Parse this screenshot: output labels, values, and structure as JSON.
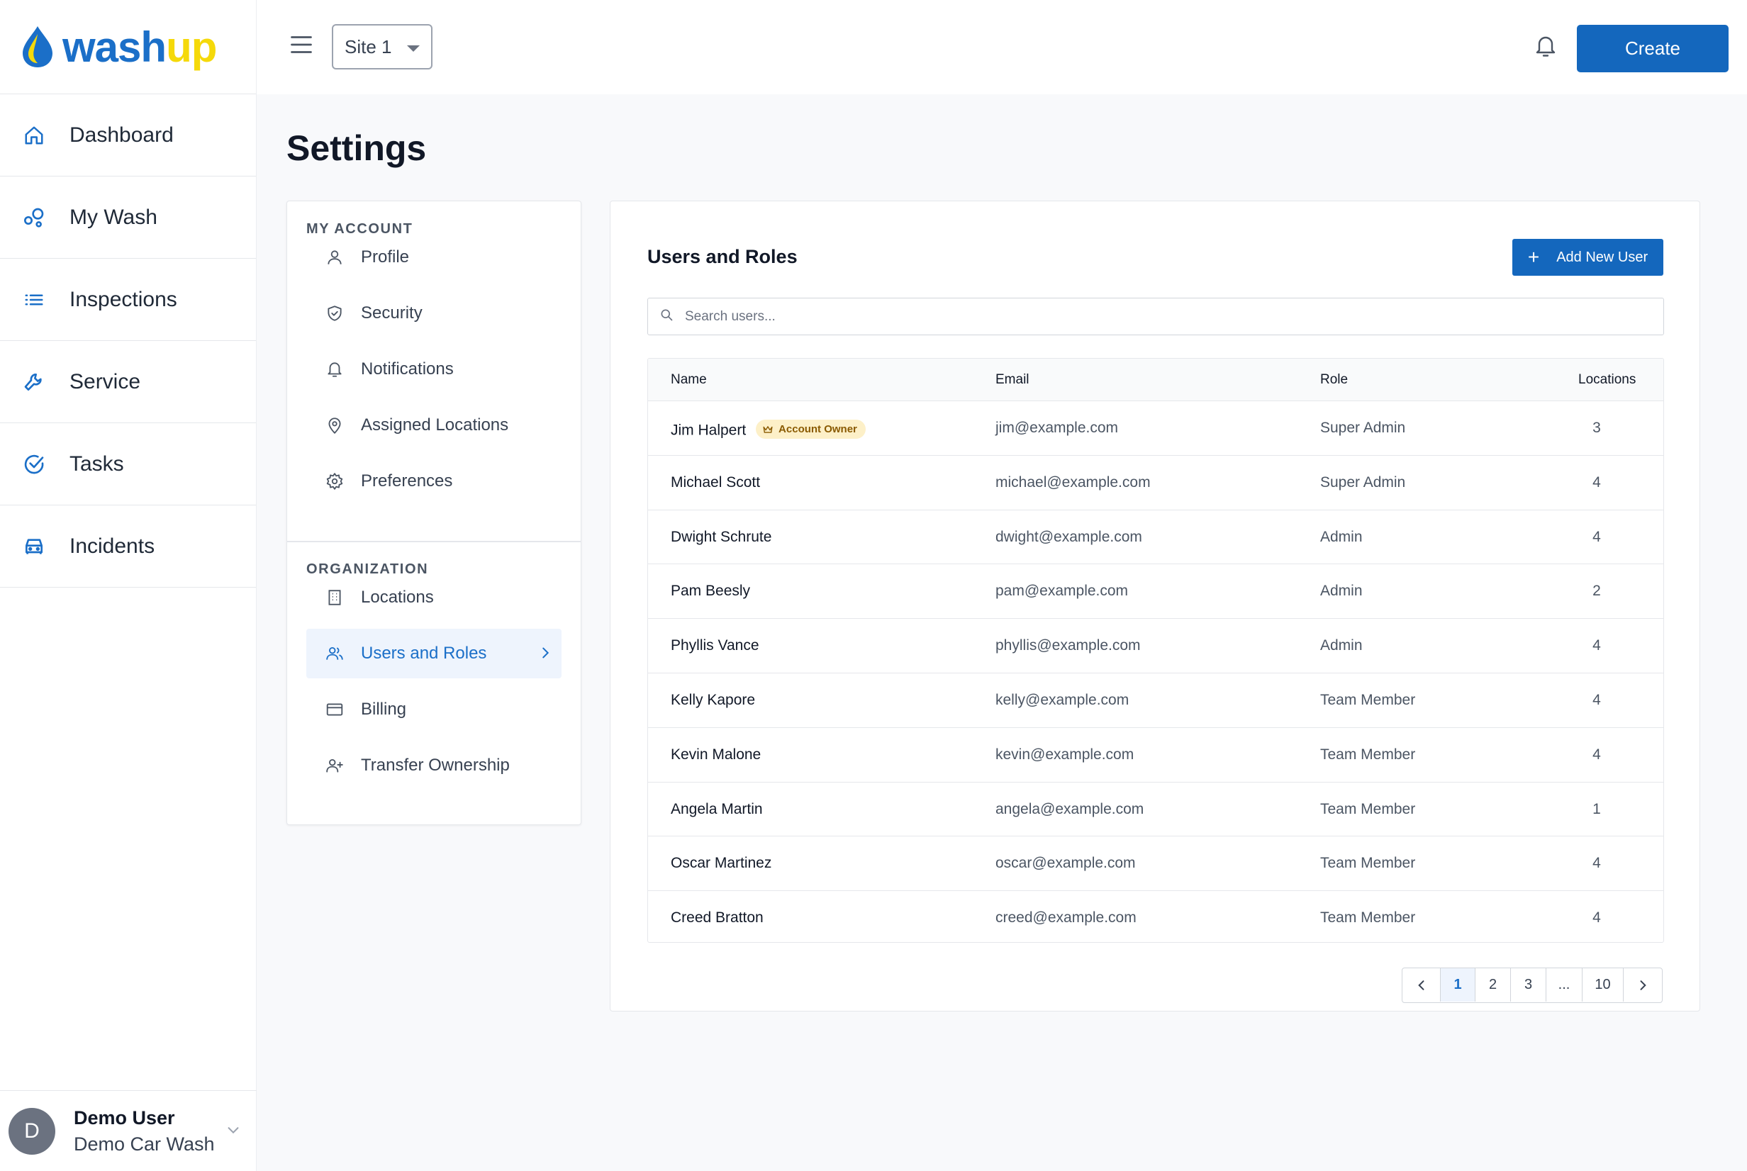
{
  "brand": {
    "name_part1": "wash",
    "name_part2": "up"
  },
  "nav": [
    {
      "label": "Dashboard",
      "icon": "home-icon"
    },
    {
      "label": "My Wash",
      "icon": "bubbles-icon"
    },
    {
      "label": "Inspections",
      "icon": "list-icon"
    },
    {
      "label": "Service",
      "icon": "wrench-icon"
    },
    {
      "label": "Tasks",
      "icon": "check-circle-icon"
    },
    {
      "label": "Incidents",
      "icon": "car-icon"
    }
  ],
  "user": {
    "initial": "D",
    "name": "Demo User",
    "org": "Demo Car Wash"
  },
  "topbar": {
    "site": "Site 1",
    "create_label": "Create"
  },
  "page": {
    "title": "Settings"
  },
  "settings_menu": {
    "my_account_title": "MY ACCOUNT",
    "my_account": [
      {
        "label": "Profile",
        "icon": "user-icon"
      },
      {
        "label": "Security",
        "icon": "shield-icon"
      },
      {
        "label": "Notifications",
        "icon": "bell-icon"
      },
      {
        "label": "Assigned Locations",
        "icon": "map-pin-icon"
      },
      {
        "label": "Preferences",
        "icon": "gear-icon"
      }
    ],
    "organization_title": "ORGANIZATION",
    "organization": [
      {
        "label": "Locations",
        "icon": "building-icon"
      },
      {
        "label": "Users and Roles",
        "icon": "users-icon",
        "active": true
      },
      {
        "label": "Billing",
        "icon": "credit-card-icon"
      },
      {
        "label": "Transfer Ownership",
        "icon": "user-plus-icon"
      }
    ]
  },
  "users_panel": {
    "title": "Users and Roles",
    "add_label": "Add New User",
    "search_placeholder": "Search users...",
    "owner_badge": "Account Owner",
    "columns": {
      "name": "Name",
      "email": "Email",
      "role": "Role",
      "locations": "Locations"
    },
    "rows": [
      {
        "name": "Jim Halpert",
        "email": "jim@example.com",
        "role": "Super Admin",
        "locations": "3",
        "owner": true
      },
      {
        "name": "Michael Scott",
        "email": "michael@example.com",
        "role": "Super Admin",
        "locations": "4"
      },
      {
        "name": "Dwight Schrute",
        "email": "dwight@example.com",
        "role": "Admin",
        "locations": "4"
      },
      {
        "name": "Pam Beesly",
        "email": "pam@example.com",
        "role": "Admin",
        "locations": "2"
      },
      {
        "name": "Phyllis Vance",
        "email": "phyllis@example.com",
        "role": "Admin",
        "locations": "4"
      },
      {
        "name": "Kelly Kapore",
        "email": "kelly@example.com",
        "role": "Team Member",
        "locations": "4"
      },
      {
        "name": "Kevin Malone",
        "email": "kevin@example.com",
        "role": "Team Member",
        "locations": "4"
      },
      {
        "name": "Angela Martin",
        "email": "angela@example.com",
        "role": "Team Member",
        "locations": "1"
      },
      {
        "name": "Oscar Martinez",
        "email": "oscar@example.com",
        "role": "Team Member",
        "locations": "4"
      },
      {
        "name": "Creed Bratton",
        "email": "creed@example.com",
        "role": "Team Member",
        "locations": "4"
      }
    ],
    "pagination": {
      "pages": [
        "1",
        "2",
        "3",
        "...",
        "10"
      ],
      "current": "1"
    }
  },
  "colors": {
    "primary": "#1467bd",
    "brand_blue": "#1b6fc8",
    "brand_yellow": "#f5d90a",
    "active_bg": "#eef4fd",
    "badge_bg": "#fdf0c8"
  }
}
